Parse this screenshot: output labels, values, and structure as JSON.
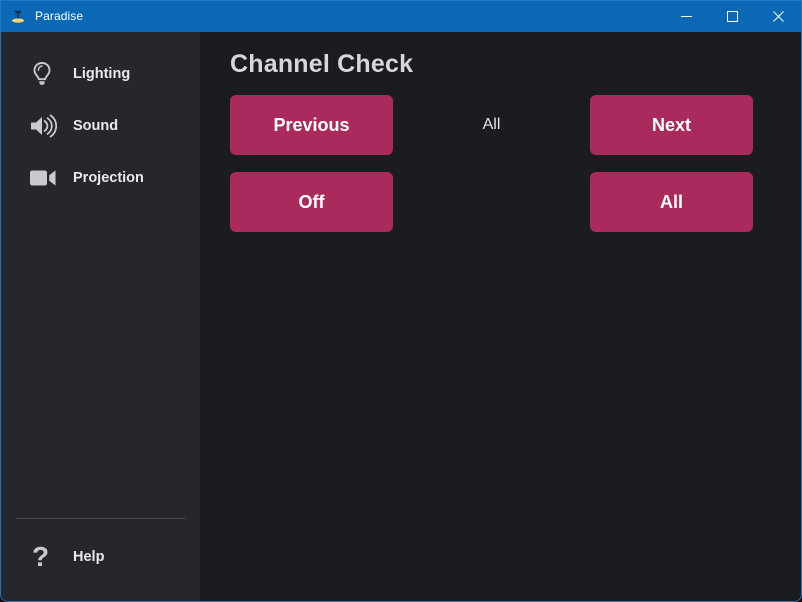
{
  "window": {
    "title": "Paradise",
    "app_icon": "palm-tree-island-icon",
    "accent_titlebar_color": "#0b68b4",
    "border_color": "#1b79c8",
    "sidebar_color": "#26272c",
    "content_color": "#1b1c20",
    "controls": {
      "minimize": "minimize-icon",
      "maximize": "maximize-icon",
      "close": "close-icon"
    }
  },
  "sidebar": {
    "items": [
      {
        "label": "Lighting",
        "icon": "lightbulb-icon"
      },
      {
        "label": "Sound",
        "icon": "speaker-waves-icon"
      },
      {
        "label": "Projection",
        "icon": "video-camera-icon"
      }
    ],
    "help": {
      "label": "Help",
      "icon": "question-mark-icon"
    }
  },
  "main": {
    "title": "Channel Check",
    "accent_color": "#ab2a5e",
    "controls": {
      "previous_label": "Previous",
      "all_label": "All",
      "next_label": "Next",
      "off_label": "Off",
      "all_button_label": "All"
    }
  }
}
